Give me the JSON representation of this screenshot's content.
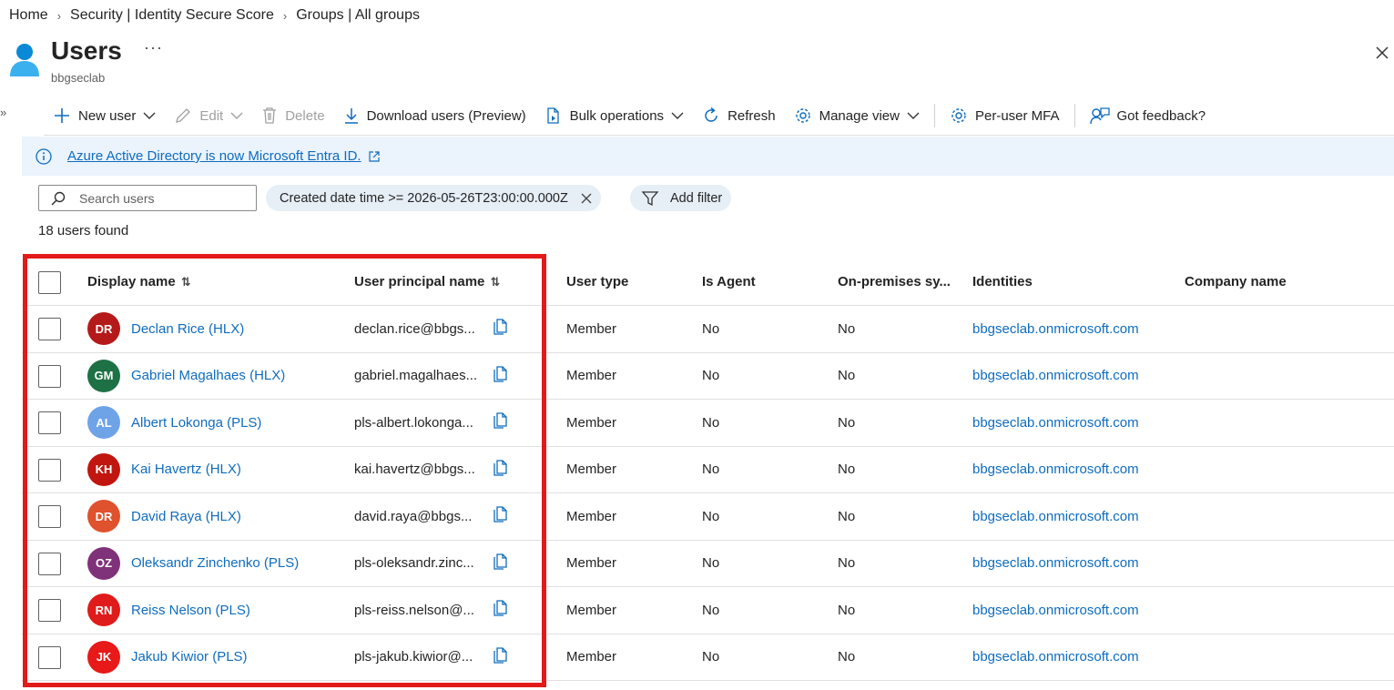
{
  "breadcrumb": [
    "Home",
    "Security | Identity Secure Score",
    "Groups | All groups"
  ],
  "header": {
    "title": "Users",
    "subtitle": "bbgseclab",
    "more": "···"
  },
  "toolbar": {
    "new_user": "New user",
    "edit": "Edit",
    "delete": "Delete",
    "download": "Download users (Preview)",
    "bulk": "Bulk operations",
    "refresh": "Refresh",
    "manage_view": "Manage view",
    "per_user_mfa": "Per-user MFA",
    "feedback": "Got feedback?"
  },
  "banner": {
    "text": "Azure Active Directory is now Microsoft Entra ID."
  },
  "search": {
    "placeholder": "Search users"
  },
  "filter": {
    "active": "Created date time >= 2026-05-26T23:00:00.000Z",
    "add": "Add filter"
  },
  "count": "18 users found",
  "columns": {
    "display_name": "Display name",
    "upn": "User principal name",
    "user_type": "User type",
    "is_agent": "Is Agent",
    "onprem": "On-premises sy...",
    "identities": "Identities",
    "company": "Company name"
  },
  "users": [
    {
      "initials": "DR",
      "color": "#b51a1a",
      "name": "Declan Rice (HLX)",
      "upn": "declan.rice@bbgs...",
      "type": "Member",
      "agent": "No",
      "onprem": "No",
      "identity": "bbgseclab.onmicrosoft.com"
    },
    {
      "initials": "GM",
      "color": "#1e7145",
      "name": "Gabriel Magalhaes (HLX)",
      "upn": "gabriel.magalhaes...",
      "type": "Member",
      "agent": "No",
      "onprem": "No",
      "identity": "bbgseclab.onmicrosoft.com"
    },
    {
      "initials": "AL",
      "color": "#6fa3e8",
      "name": "Albert Lokonga (PLS)",
      "upn": "pls-albert.lokonga...",
      "type": "Member",
      "agent": "No",
      "onprem": "No",
      "identity": "bbgseclab.onmicrosoft.com"
    },
    {
      "initials": "KH",
      "color": "#c0160f",
      "name": "Kai Havertz (HLX)",
      "upn": "kai.havertz@bbgs...",
      "type": "Member",
      "agent": "No",
      "onprem": "No",
      "identity": "bbgseclab.onmicrosoft.com"
    },
    {
      "initials": "DR",
      "color": "#e0512d",
      "name": "David Raya (HLX)",
      "upn": "david.raya@bbgs...",
      "type": "Member",
      "agent": "No",
      "onprem": "No",
      "identity": "bbgseclab.onmicrosoft.com"
    },
    {
      "initials": "OZ",
      "color": "#7f3279",
      "name": "Oleksandr Zinchenko (PLS)",
      "upn": "pls-oleksandr.zinc...",
      "type": "Member",
      "agent": "No",
      "onprem": "No",
      "identity": "bbgseclab.onmicrosoft.com"
    },
    {
      "initials": "RN",
      "color": "#e01b1b",
      "name": "Reiss Nelson (PLS)",
      "upn": "pls-reiss.nelson@...",
      "type": "Member",
      "agent": "No",
      "onprem": "No",
      "identity": "bbgseclab.onmicrosoft.com"
    },
    {
      "initials": "JK",
      "color": "#e81919",
      "name": "Jakub Kiwior (PLS)",
      "upn": "pls-jakub.kiwior@...",
      "type": "Member",
      "agent": "No",
      "onprem": "No",
      "identity": "bbgseclab.onmicrosoft.com"
    }
  ]
}
